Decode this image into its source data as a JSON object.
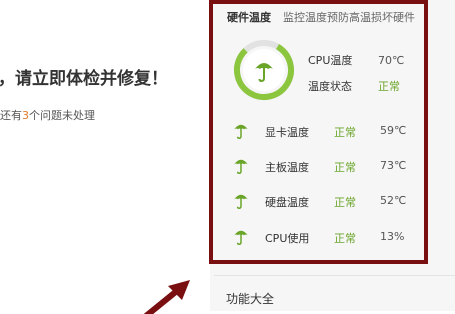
{
  "left": {
    "title": "，请立即体检并修复！",
    "subtitle_prefix": "还有",
    "subtitle_count": "3",
    "subtitle_suffix": "个问题未处理"
  },
  "panel": {
    "title": "硬件温度",
    "description": "监控温度预防高温损坏硬件",
    "cpu": {
      "temp_label": "CPU温度",
      "temp_value": "70℃",
      "status_label": "温度状态",
      "status_value": "正常"
    },
    "rows": [
      {
        "label": "显卡温度",
        "status": "正常",
        "value": "59℃",
        "icon": "umbrella-icon"
      },
      {
        "label": "主板温度",
        "status": "正常",
        "value": "73℃",
        "icon": "umbrella-icon"
      },
      {
        "label": "硬盘温度",
        "status": "正常",
        "value": "52℃",
        "icon": "umbrella-icon"
      },
      {
        "label": "CPU使用",
        "status": "正常",
        "value": "13%",
        "icon": "umbrella-icon"
      }
    ]
  },
  "section": {
    "title": "功能大全"
  },
  "colors": {
    "accent_green": "#6aa52a",
    "highlight_border": "#7a0f12",
    "count_orange": "#e07a2a"
  }
}
